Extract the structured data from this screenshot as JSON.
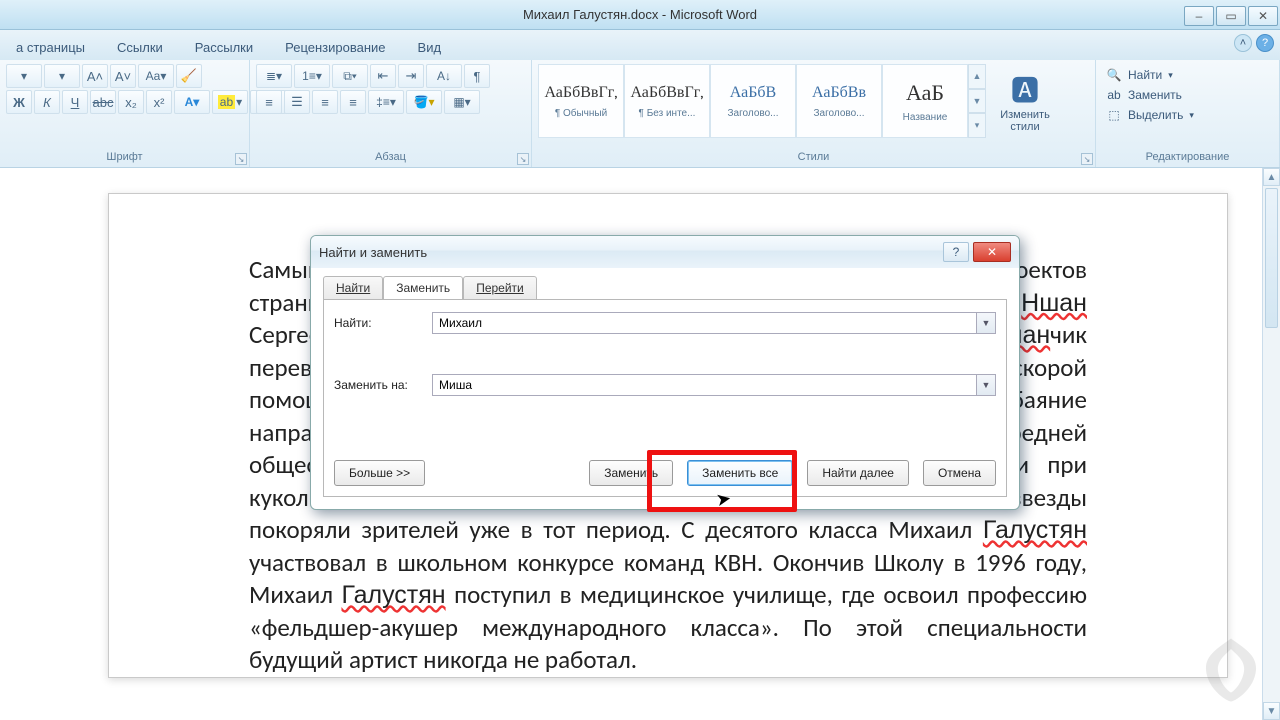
{
  "title": "Михаил Галустян.docx - Microsoft Word",
  "tabs": {
    "page": "а страницы",
    "links": "Ссылки",
    "mail": "Рассылки",
    "review": "Рецензирование",
    "view": "Вид"
  },
  "ribbon": {
    "font_label": "Шрифт",
    "para_label": "Абзац",
    "styles_label": "Стили",
    "edit_label": "Редактирование",
    "change_styles": "Изменить\nстили",
    "find": "Найти",
    "replace": "Заменить",
    "select": "Выделить",
    "styles": [
      {
        "preview": "АаБбВвГг,",
        "name": "¶ Обычный"
      },
      {
        "preview": "АаБбВвГг,",
        "name": "¶ Без инте..."
      },
      {
        "preview": "АаБбВ",
        "name": "Заголово..."
      },
      {
        "preview": "АаБбВв",
        "name": "Заголово..."
      },
      {
        "preview": "АаБ",
        "name": "Название"
      }
    ]
  },
  "document_text": "Самый известный и самый маленький резидент всех комедийных проектов страны. При рожденье в 1979 году получил замысловатое имя Ншан Сергеевич Галустян. Однако впоследствии малоизвестный Ншанчик перевоплотился в очень популярного Мишу. Сын кондитера и врача скорой помощи, рос шустрым и веселым ребенком. Свою энергию и обаяние направил в русло актерского искусства. С самого начала учебы в средней общеобразовательной школе будущий артист занимался в студии при кукольном театре. Врожденный артистизм и харизма будущей звезды покоряли зрителей уже в тот период. С десятого класса Михаил Галустян участвовал в школьном конкурсе команд КВН. Окончив Школу в 1996 году, Михаил Галустян поступил в медицинское училище, где освоил профессию «фельдшер-акушер международного класса». По этой специальности будущий артист никогда не работал.",
  "dialog": {
    "title": "Найти и заменить",
    "tabs": {
      "find": "Найти",
      "replace": "Заменить",
      "goto": "Перейти"
    },
    "find_label": "Найти:",
    "replace_label": "Заменить на:",
    "find_value": "Михаил",
    "replace_value": "Миша",
    "more": "Больше >>",
    "btn_replace": "Заменить",
    "btn_replace_all": "Заменить все",
    "btn_find_next": "Найти далее",
    "btn_cancel": "Отмена"
  }
}
